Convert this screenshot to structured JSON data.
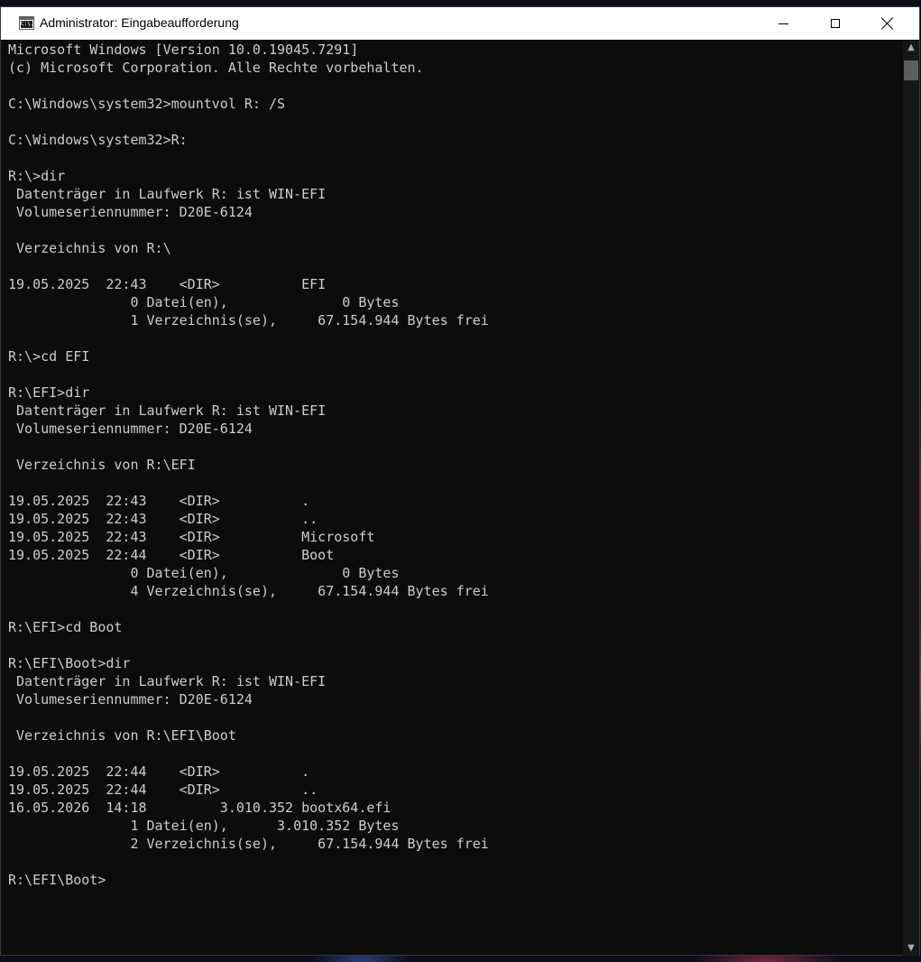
{
  "window": {
    "title": "Administrator: Eingabeaufforderung",
    "icon": "cmd-icon",
    "icon_text": "C:\\."
  },
  "controls": {
    "minimize_icon": "minimize-icon",
    "maximize_icon": "maximize-icon",
    "close_icon": "close-icon"
  },
  "console": {
    "lines": [
      "Microsoft Windows [Version 10.0.19045.7291]",
      "(c) Microsoft Corporation. Alle Rechte vorbehalten.",
      "",
      "C:\\Windows\\system32>mountvol R: /S",
      "",
      "C:\\Windows\\system32>R:",
      "",
      "R:\\>dir",
      " Datenträger in Laufwerk R: ist WIN-EFI",
      " Volumeseriennummer: D20E-6124",
      "",
      " Verzeichnis von R:\\",
      "",
      "19.05.2025  22:43    <DIR>          EFI",
      "               0 Datei(en),              0 Bytes",
      "               1 Verzeichnis(se),     67.154.944 Bytes frei",
      "",
      "R:\\>cd EFI",
      "",
      "R:\\EFI>dir",
      " Datenträger in Laufwerk R: ist WIN-EFI",
      " Volumeseriennummer: D20E-6124",
      "",
      " Verzeichnis von R:\\EFI",
      "",
      "19.05.2025  22:43    <DIR>          .",
      "19.05.2025  22:43    <DIR>          ..",
      "19.05.2025  22:43    <DIR>          Microsoft",
      "19.05.2025  22:44    <DIR>          Boot",
      "               0 Datei(en),              0 Bytes",
      "               4 Verzeichnis(se),     67.154.944 Bytes frei",
      "",
      "R:\\EFI>cd Boot",
      "",
      "R:\\EFI\\Boot>dir",
      " Datenträger in Laufwerk R: ist WIN-EFI",
      " Volumeseriennummer: D20E-6124",
      "",
      " Verzeichnis von R:\\EFI\\Boot",
      "",
      "19.05.2025  22:44    <DIR>          .",
      "19.05.2025  22:44    <DIR>          ..",
      "16.05.2026  14:18         3.010.352 bootx64.efi",
      "               1 Datei(en),      3.010.352 Bytes",
      "               2 Verzeichnis(se),     67.154.944 Bytes frei",
      "",
      "R:\\EFI\\Boot>"
    ]
  },
  "colors": {
    "console_bg": "#0c0c0c",
    "console_text": "#cccccc",
    "titlebar_bg": "#ffffff"
  }
}
